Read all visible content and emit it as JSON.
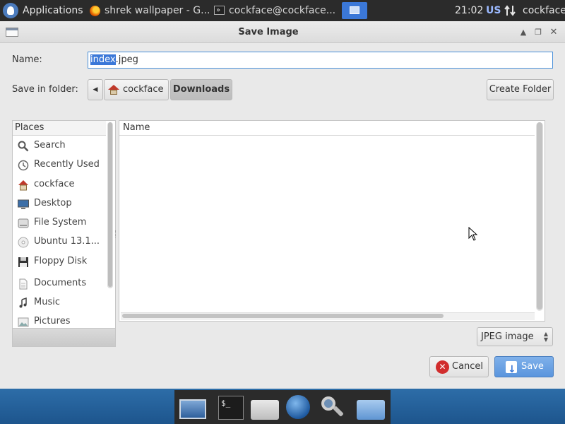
{
  "top_panel": {
    "applications_label": "Applications",
    "tasks": [
      {
        "label": "shrek wallpaper - G...",
        "icon": "firefox-icon"
      },
      {
        "label": "cockface@cockface...",
        "icon": "terminal-icon"
      }
    ],
    "clock": "21:02",
    "keyboard_layout": "US",
    "username": "cockface"
  },
  "dialog": {
    "title": "Save Image",
    "name_label": "Name:",
    "name_value_selected": "index",
    "name_value_rest": ".jpeg",
    "save_in_label": "Save in folder:",
    "path": [
      "cockface",
      "Downloads"
    ],
    "create_folder_label": "Create Folder",
    "places_header": "Places",
    "places": [
      {
        "label": "Search",
        "icon": "search-icon"
      },
      {
        "label": "Recently Used",
        "icon": "clock-icon"
      },
      {
        "label": "cockface",
        "icon": "home-icon"
      },
      {
        "label": "Desktop",
        "icon": "desktop-icon"
      },
      {
        "label": "File System",
        "icon": "drive-icon"
      },
      {
        "label": "Ubuntu 13.1...",
        "icon": "optical-disc-icon"
      },
      {
        "label": "Floppy Disk",
        "icon": "floppy-icon"
      },
      {
        "label": "Documents",
        "icon": "documents-icon"
      },
      {
        "label": "Music",
        "icon": "music-icon"
      },
      {
        "label": "Pictures",
        "icon": "pictures-icon"
      }
    ],
    "files_column_name": "Name",
    "file_type": "JPEG image",
    "cancel_label": "Cancel",
    "save_label": "Save"
  },
  "colors": {
    "accent": "#3b78d8",
    "panel": "#2b2b2b",
    "desktop": "#2d6da8"
  }
}
